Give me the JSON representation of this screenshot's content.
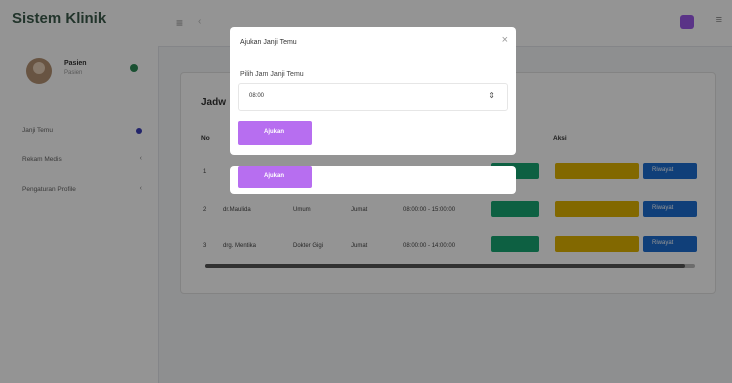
{
  "sidebar": {
    "brand": "Sistem Klinik",
    "user": {
      "name": "Pasien",
      "role": "Pasien"
    },
    "items": [
      {
        "label": "Janji Temu",
        "dot_color": "#3b3fb8"
      },
      {
        "label": "Rekam Medis",
        "caret": "‹"
      },
      {
        "label": "Pengaturan Profile",
        "caret": "‹"
      }
    ]
  },
  "topbar": {
    "menu_icon": "hamburger-icon",
    "grid_icon": "menu-icon",
    "accent": "#9b59e8"
  },
  "card": {
    "title": "Jadw",
    "headers": [
      "No",
      "Aksi"
    ],
    "rows": [
      {
        "no": "1",
        "doctor": "",
        "poli": "",
        "day": "",
        "time": "",
        "button": ""
      },
      {
        "no": "2",
        "doctor": "dr.Maulida",
        "poli": "Umum",
        "day": "Jumat",
        "time": "08:00:00 - 15:00:00"
      },
      {
        "no": "3",
        "doctor": "drg. Mentika",
        "poli": "Dokter Gigi",
        "day": "Jumat",
        "time": "08:00:00 - 14:00:00"
      }
    ],
    "btn_green": "",
    "btn_yellow": "",
    "btn_blue": "Riwayat"
  },
  "footer": "",
  "modal": {
    "title": "Ajukan Janji Temu",
    "close": "×",
    "label": "Pilih Jam Janji Temu",
    "select_value": "08:00",
    "submit": "Ajukan"
  },
  "modal2": {
    "submit": "Ajukan"
  },
  "colors": {
    "overlay": "rgba(0,0,0,0.42)",
    "purple": "#b76ef0",
    "green": "#17a673",
    "yellow": "#e0b400",
    "blue": "#1c6dd0"
  }
}
